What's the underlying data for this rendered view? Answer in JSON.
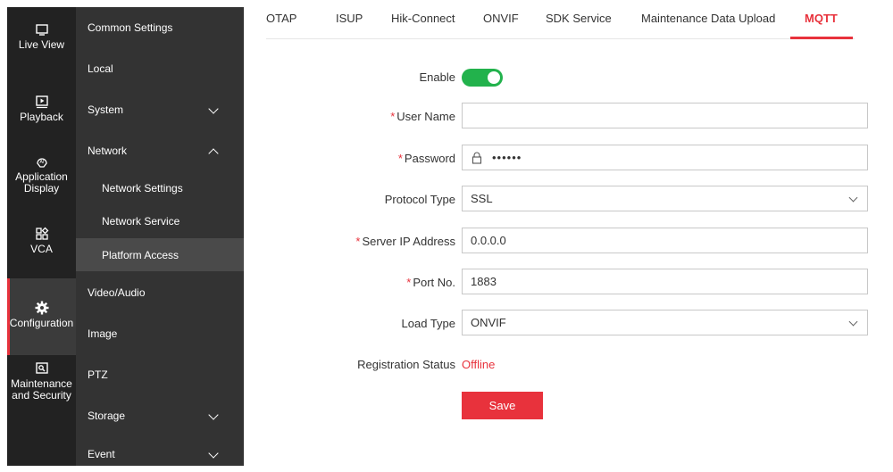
{
  "nav": {
    "items": [
      {
        "label": "Live View",
        "icon": "live-view-icon"
      },
      {
        "label": "Playback",
        "icon": "playback-icon"
      },
      {
        "label": "Application Display",
        "icon": "ai-icon"
      },
      {
        "label": "VCA",
        "icon": "vca-icon"
      },
      {
        "label": "Configuration",
        "icon": "gear-icon"
      },
      {
        "label": "Maintenance and Security",
        "icon": "maintenance-icon"
      }
    ]
  },
  "menu": {
    "items": [
      {
        "label": "Common Settings"
      },
      {
        "label": "Local"
      },
      {
        "label": "System"
      },
      {
        "label": "Network"
      },
      {
        "label": "Network Settings"
      },
      {
        "label": "Network Service"
      },
      {
        "label": "Platform Access"
      },
      {
        "label": "Video/Audio"
      },
      {
        "label": "Image"
      },
      {
        "label": "PTZ"
      },
      {
        "label": "Storage"
      },
      {
        "label": "Event"
      }
    ]
  },
  "tabs": [
    {
      "label": "OTAP"
    },
    {
      "label": "ISUP"
    },
    {
      "label": "Hik-Connect"
    },
    {
      "label": "ONVIF"
    },
    {
      "label": "SDK Service"
    },
    {
      "label": "Maintenance Data Upload"
    },
    {
      "label": "MQTT"
    }
  ],
  "form": {
    "required_mark": "*",
    "enable_label": "Enable",
    "enable_on": true,
    "username_label": "User Name",
    "username_value": "",
    "password_label": "Password",
    "password_value": "••••••",
    "protocol_label": "Protocol Type",
    "protocol_value": "SSL",
    "server_ip_label": "Server IP Address",
    "server_ip_value": "0.0.0.0",
    "port_label": "Port No.",
    "port_value": "1883",
    "load_type_label": "Load Type",
    "load_type_value": "ONVIF",
    "registration_label": "Registration Status",
    "registration_value": "Offline",
    "save_label": "Save"
  },
  "colors": {
    "accent": "#e8323c",
    "toggle_on": "#22b24c",
    "nav_bg": "#222222",
    "menu_bg": "#333333"
  }
}
